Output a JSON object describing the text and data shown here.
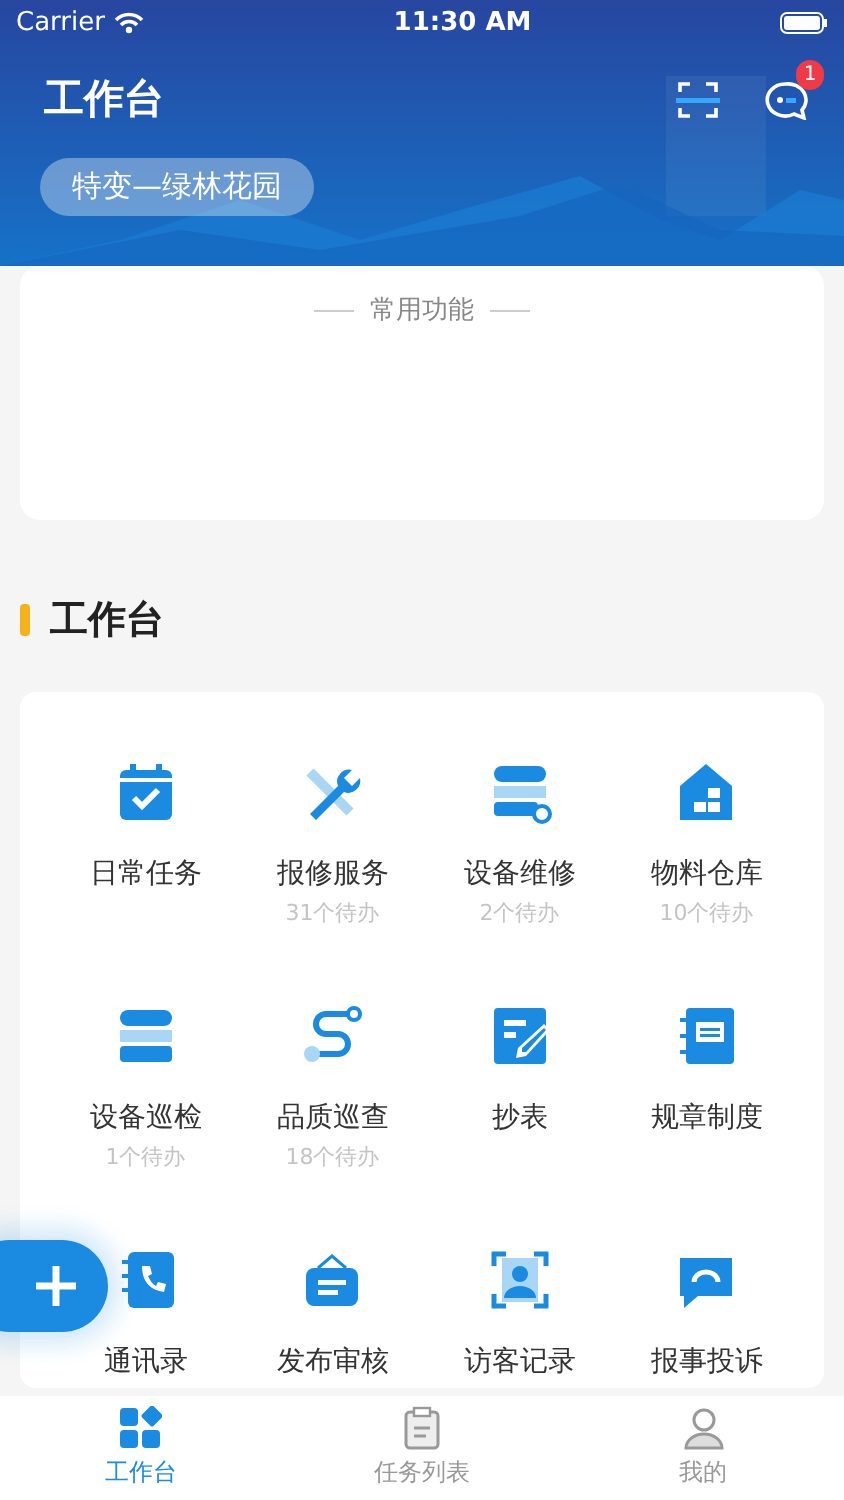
{
  "status_bar": {
    "carrier": "Carrier",
    "time": "11:30 AM"
  },
  "header": {
    "title": "工作台",
    "project": "特变—绿林花园",
    "message_badge": "1"
  },
  "common_functions": {
    "title": "常用功能"
  },
  "section": {
    "title": "工作台"
  },
  "apps": [
    {
      "label": "日常任务"
    },
    {
      "label": "报修服务",
      "pending": "31个待办"
    },
    {
      "label": "设备维修",
      "pending": "2个待办"
    },
    {
      "label": "物料仓库",
      "pending": "10个待办"
    },
    {
      "label": "设备巡检",
      "pending": "1个待办"
    },
    {
      "label": "品质巡查",
      "pending": "18个待办"
    },
    {
      "label": "抄表"
    },
    {
      "label": "规章制度"
    },
    {
      "label": "通讯录"
    },
    {
      "label": "发布审核"
    },
    {
      "label": "访客记录"
    },
    {
      "label": "报事投诉"
    }
  ],
  "tab_bar": [
    {
      "label": "工作台",
      "selected": true
    },
    {
      "label": "任务列表",
      "selected": false
    },
    {
      "label": "我的",
      "selected": false
    }
  ]
}
